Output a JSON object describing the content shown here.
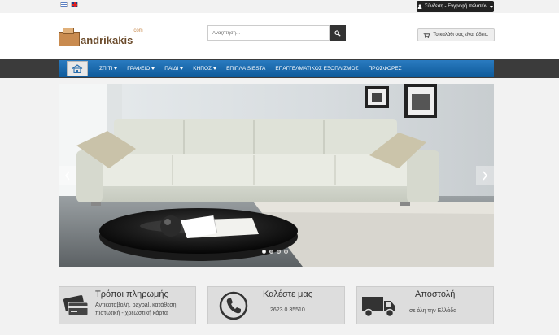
{
  "topbar": {
    "languages": [
      "el",
      "en"
    ],
    "login_label": "Σύνδεση - Εγγραφή πελατών"
  },
  "header": {
    "logo_text": "andrikakis",
    "logo_suffix": "com",
    "search_placeholder": "Αναζήτηση...",
    "cart_label": "Το καλάθι σας είναι άδειο."
  },
  "nav": {
    "items": [
      {
        "label": "ΣΠΙΤΙ",
        "dropdown": true
      },
      {
        "label": "ΓΡΑΦΕΙΟ",
        "dropdown": true
      },
      {
        "label": "ΠΑΙΔΙ",
        "dropdown": true
      },
      {
        "label": "ΚΗΠΟΣ",
        "dropdown": true
      },
      {
        "label": "ΕΠΙΠΛΑ SIESTA",
        "dropdown": false
      },
      {
        "label": "ΕΠΑΓΓΕΛΜΑΤΙΚΟΣ ΕΞΟΠΛΙΣΜΟΣ",
        "dropdown": false
      },
      {
        "label": "ΠΡΟΣΦΟΡΕΣ",
        "dropdown": false
      }
    ]
  },
  "slider": {
    "slide_count": 4,
    "active_slide": 1
  },
  "features": {
    "payment": {
      "title": "Τρόποι πληρωμής",
      "line1": "Αντικαταβολή, paypal, κατάθεση,",
      "line2": "πιστωτική - χρεωστική κάρτα"
    },
    "phone": {
      "title": "Καλέστε μας",
      "number": "2623 0 35510"
    },
    "shipping": {
      "title": "Αποστολή",
      "subtitle": "σε όλη την Ελλάδα"
    }
  }
}
